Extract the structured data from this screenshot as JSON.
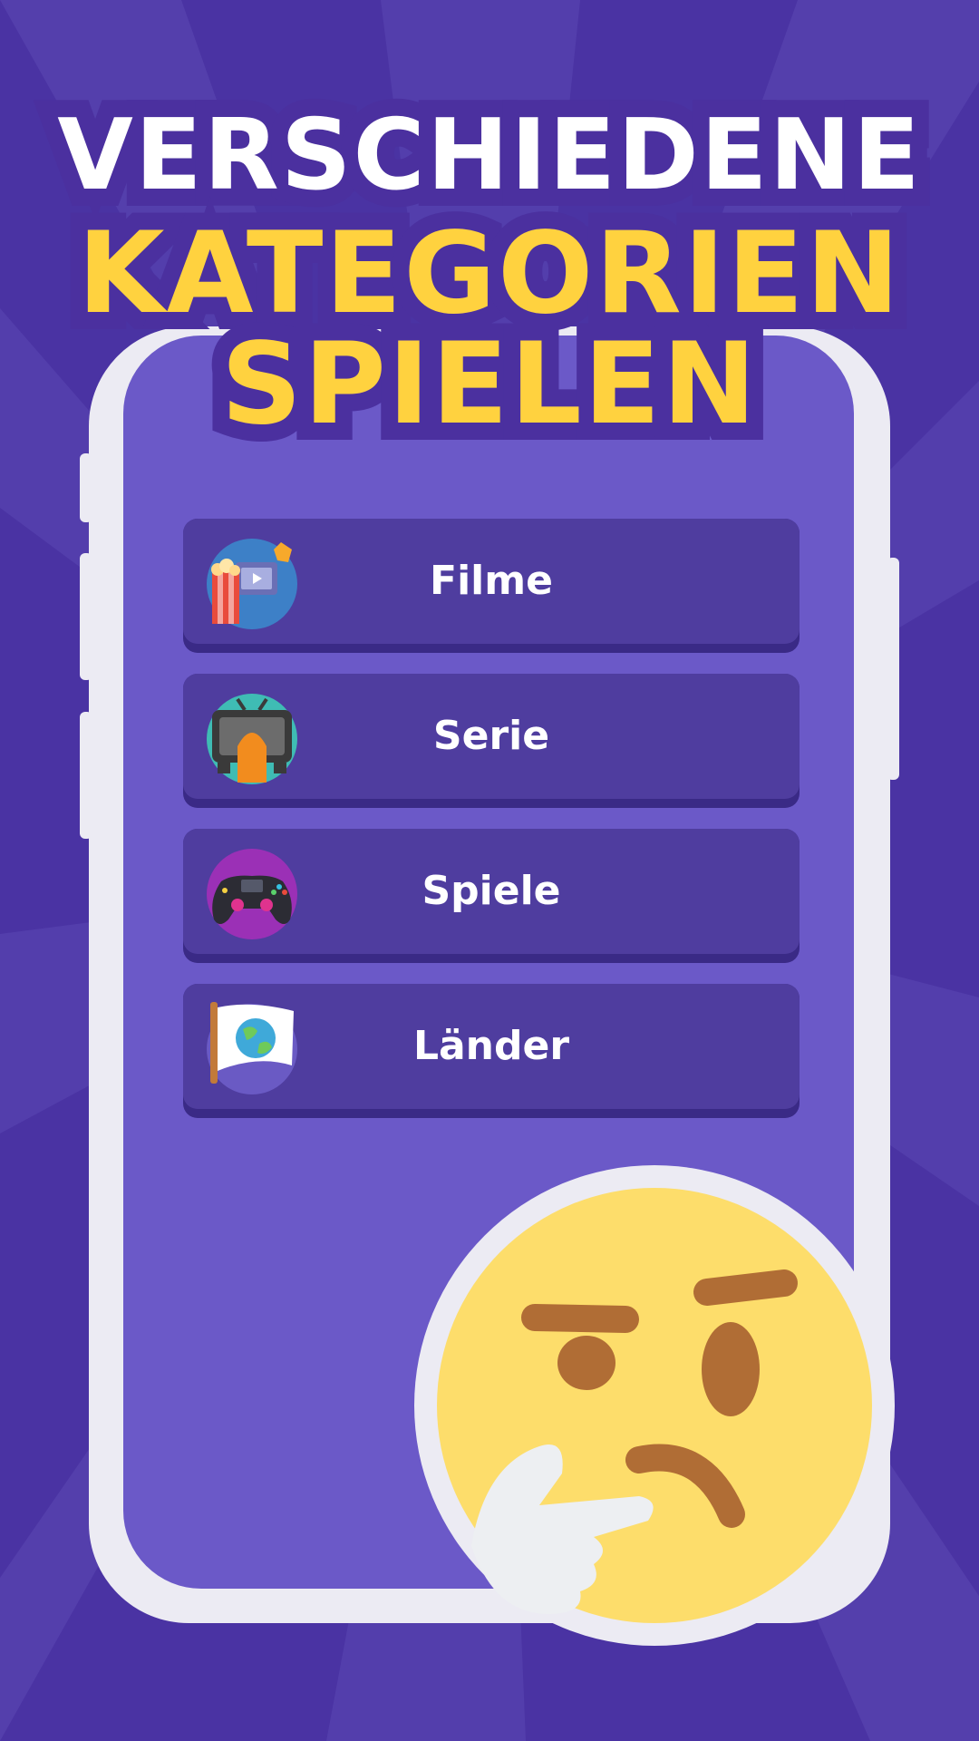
{
  "headline": {
    "line1": "VERSCHIEDENE",
    "line2": "KATEGORIEN",
    "line3": "SPIELEN"
  },
  "categories": [
    {
      "label": "Filme",
      "icon": "popcorn-film-icon"
    },
    {
      "label": "Serie",
      "icon": "tv-icon"
    },
    {
      "label": "Spiele",
      "icon": "gamepad-icon"
    },
    {
      "label": "Länder",
      "icon": "globe-flag-icon"
    }
  ],
  "decoration": {
    "emoji": "thinking-face-emoji"
  },
  "colors": {
    "background": "#4a33a3",
    "phone_frame": "#ecebf3",
    "screen": "#6b59c8",
    "button": "#4f3d9f",
    "headline_white": "#ffffff",
    "headline_yellow": "#ffd23f"
  }
}
